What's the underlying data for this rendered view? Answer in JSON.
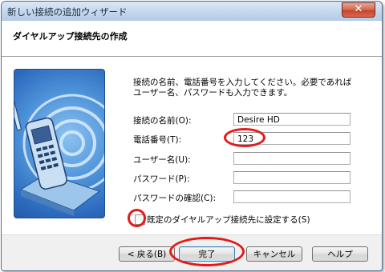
{
  "window": {
    "title": "新しい接続の追加ウィザード"
  },
  "header": {
    "title": "ダイヤルアップ接続先の作成"
  },
  "main": {
    "description": "接続の名前、電話番号を入力してください。必要であればユーザー名、パスワードも入力できます。",
    "fields": [
      {
        "label": "接続の名前(O):",
        "value": "Desire HD"
      },
      {
        "label": "電話番号(T):",
        "value": "123"
      },
      {
        "label": "ユーザー名(U):",
        "value": ""
      },
      {
        "label": "パスワード(P):",
        "value": ""
      },
      {
        "label": "パスワードの確認(C):",
        "value": ""
      }
    ],
    "default_checkbox_label": "既定のダイヤルアップ接続先に設定する(S)"
  },
  "footer": {
    "back_label": "< 戻る(B)",
    "finish_label": "完了",
    "cancel_label": "キャンセル",
    "help_label": "ヘルプ"
  },
  "icons": {
    "close": "close-icon",
    "illustration": "phone-signal-illustration"
  },
  "colors": {
    "annotation_ring": "#e21a1a",
    "art_blue": "#2d6bbf"
  }
}
